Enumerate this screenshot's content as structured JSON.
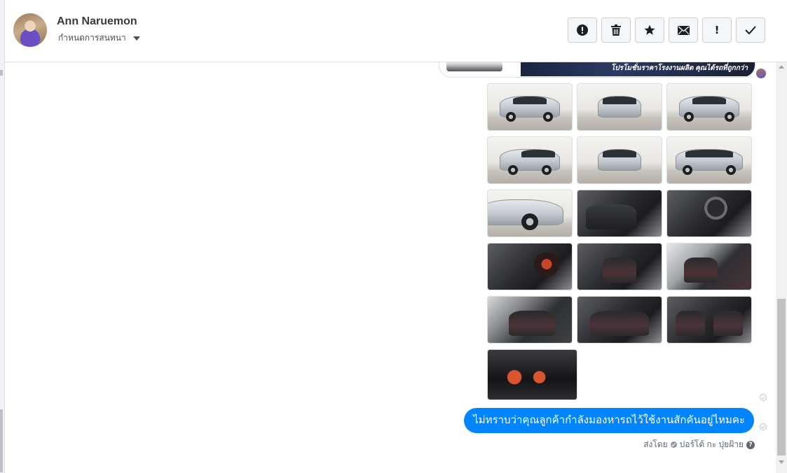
{
  "header": {
    "contact_name": "Ann Naruemon",
    "conversation_setting": "กำหนดการสนทนา"
  },
  "toolbar": {
    "buttons": [
      {
        "icon": "report-icon"
      },
      {
        "icon": "trash-icon"
      },
      {
        "icon": "star-icon"
      },
      {
        "icon": "envelope-icon"
      },
      {
        "icon": "important-icon",
        "label": "!"
      },
      {
        "icon": "check-icon"
      }
    ]
  },
  "conversation": {
    "promo_banner_text": "โปรโมชั่นราคาโรงงานผลิต คุณได้รถที่ถูกกว่า",
    "photo_grid": [
      "exterior",
      "exterior",
      "exterior",
      "exterior",
      "exterior",
      "exterior",
      "exterior",
      "interior",
      "interior",
      "interior",
      "interior",
      "interior",
      "interior",
      "interior",
      "interior",
      "dashboard"
    ],
    "message_text": "ไม่ทราบว่าคุณลูกค้ากำลังมองหารถไว้ใช้งานสักคันอยู่ไหมคะ",
    "sent_by_prefix": "ส่งโดย",
    "sent_by_name": "ปอร์โต้ กะ ปุยฝ้าย",
    "help_glyph": "?"
  },
  "colors": {
    "accent": "#0084ff",
    "toolbar_bg": "#f5f6f7",
    "border": "#dddfe2"
  }
}
